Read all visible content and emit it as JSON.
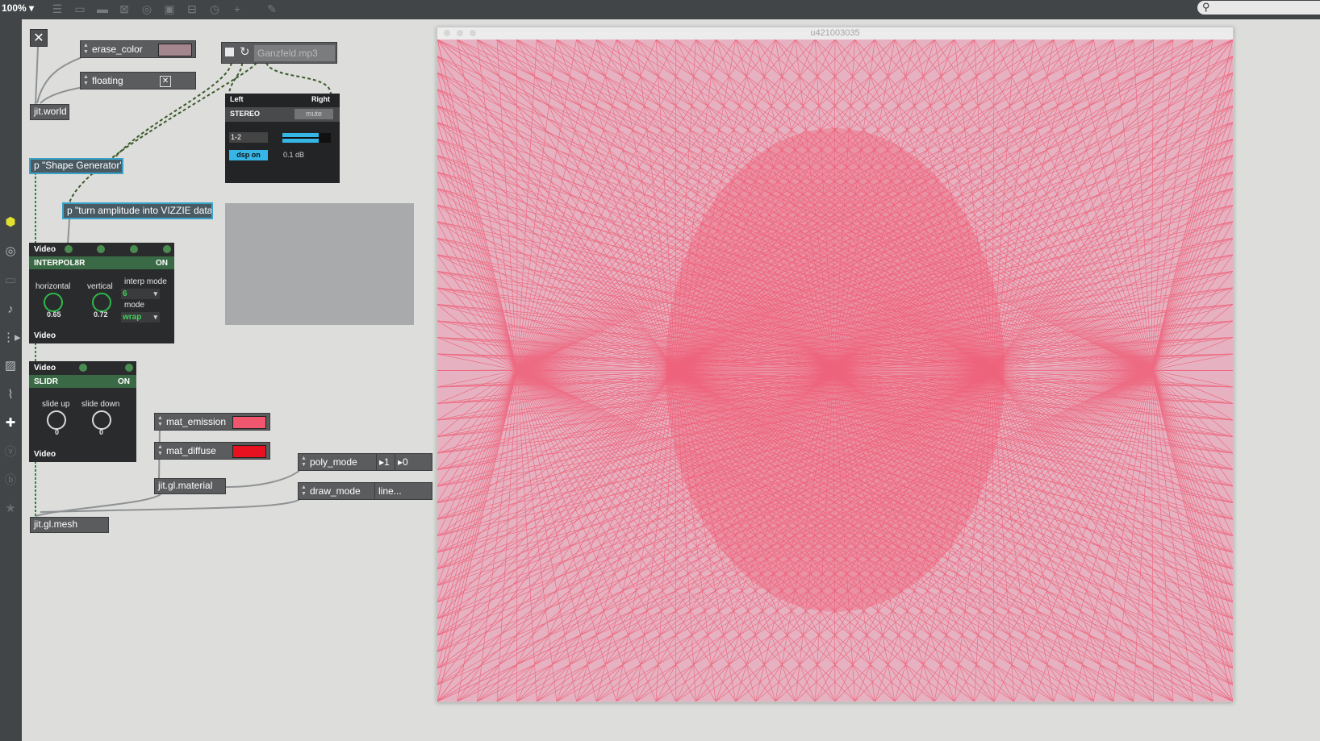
{
  "toolbar": {
    "zoom": "100%",
    "icons": [
      "list-icon",
      "window-icon",
      "comment-icon",
      "close-box-icon",
      "target-icon",
      "play-icon",
      "split-icon",
      "clock-icon",
      "plus-icon",
      "paint-icon"
    ]
  },
  "sidebar": {
    "icons": [
      "cube-icon",
      "circle-icon",
      "rectangle-icon",
      "note-icon",
      "step-icon",
      "image-icon",
      "paperclip-icon",
      "puzzle-icon",
      "v-icon",
      "b-icon",
      "star-icon"
    ]
  },
  "patch": {
    "erase_color": {
      "label": "erase_color",
      "color": "#a4868f"
    },
    "floating": {
      "label": "floating",
      "toggle": "✕"
    },
    "jit_world": "jit.world",
    "player": {
      "file": "Ganzfeld.mp3"
    },
    "ezdac": {
      "left": "Left",
      "right": "Right",
      "stereo": "STEREO",
      "mute": "mute",
      "channels": "1-2",
      "dsp": "dsp on",
      "level": "0.1 dB",
      "meter_level": 0.75
    },
    "shape_gen": "p \"Shape Generator\"",
    "amp_to_vizzie": "p \"turn amplitude into VIZZIE data\"",
    "interpolator": {
      "video_in": "Video",
      "name": "INTERPOL8R",
      "on": "ON",
      "horizontal_label": "horizontal",
      "horizontal_value": "0.65",
      "vertical_label": "vertical",
      "vertical_value": "0.72",
      "interp_mode_label": "interp mode",
      "interp_mode_value": "6",
      "mode_label": "mode",
      "mode_value": "wrap",
      "video_out": "Video"
    },
    "slider": {
      "video_in": "Video",
      "name": "SLIDR",
      "on": "ON",
      "up_label": "slide up",
      "up_value": "0",
      "down_label": "slide down",
      "down_value": "0",
      "video_out": "Video"
    },
    "mat_emission": {
      "label": "mat_emission",
      "color": "#f0566e"
    },
    "mat_diffuse": {
      "label": "mat_diffuse",
      "color": "#e8111f"
    },
    "poly_mode": {
      "label": "poly_mode",
      "val1": "1",
      "val2": "0"
    },
    "draw_mode": {
      "label": "draw_mode",
      "value": "line..."
    },
    "jit_gl_material": "jit.gl.material",
    "jit_gl_mesh": "jit.gl.mesh"
  },
  "video_window": {
    "title": "u421003035",
    "background": "#e6b2c1",
    "line_color": "#f0546f"
  }
}
